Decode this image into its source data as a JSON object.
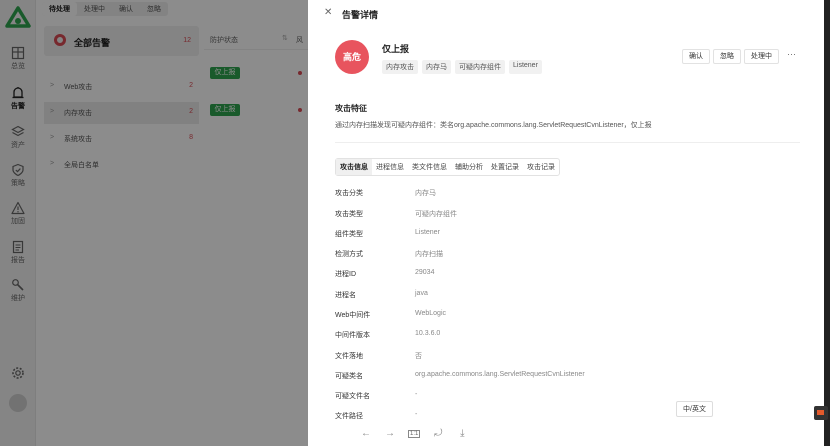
{
  "rail": {
    "items": [
      {
        "label": "总览",
        "icon": "dashboard-icon"
      },
      {
        "label": "告警",
        "icon": "alarm-icon"
      },
      {
        "label": "资产",
        "icon": "layers-icon"
      },
      {
        "label": "策略",
        "icon": "shield-icon"
      },
      {
        "label": "加固",
        "icon": "warning-icon"
      },
      {
        "label": "报告",
        "icon": "report-icon"
      },
      {
        "label": "维护",
        "icon": "wrench-icon"
      }
    ],
    "active_index": 1
  },
  "status_tabs": [
    "待处理",
    "处理中",
    "确认",
    "忽略"
  ],
  "categories": {
    "head": {
      "label": "全部告警",
      "count": "12"
    },
    "rows": [
      {
        "label": "Web攻击",
        "count": "2"
      },
      {
        "label": "内存攻击",
        "count": "2"
      },
      {
        "label": "系统攻击",
        "count": "8"
      },
      {
        "label": "全局白名单",
        "count": ""
      }
    ]
  },
  "list": {
    "col_status": "防护状态",
    "col_risk": "风",
    "tag": "仅上报"
  },
  "drawer": {
    "title": "告警详情",
    "level": "高危",
    "attack_name": "仅上报",
    "tags": [
      "内存攻击",
      "内存马",
      "可疑内存组件",
      "Listener"
    ],
    "actions": [
      "确认",
      "忽略",
      "处理中"
    ],
    "more": "···",
    "feature_title": "攻击特征",
    "feature_desc": "通过内存扫描发现可疑内存组件：类名org.apache.commons.lang.ServletRequestCvnListener，仅上报",
    "tabs": [
      "攻击信息",
      "进程信息",
      "类文件信息",
      "辅助分析",
      "处置记录",
      "攻击记录"
    ],
    "fields": [
      {
        "key": "攻击分类",
        "value": "内存马"
      },
      {
        "key": "攻击类型",
        "value": "可疑内存组件"
      },
      {
        "key": "组件类型",
        "value": "Listener"
      },
      {
        "key": "检测方式",
        "value": "内存扫描"
      },
      {
        "key": "进程ID",
        "value": "29034"
      },
      {
        "key": "进程名",
        "value": "java"
      },
      {
        "key": "Web中间件",
        "value": "WebLogic"
      },
      {
        "key": "中间件版本",
        "value": "10.3.6.0"
      },
      {
        "key": "文件落地",
        "value": "否"
      },
      {
        "key": "可疑类名",
        "value": "org.apache.commons.lang.ServletRequestCvnListener"
      },
      {
        "key": "可疑文件名",
        "value": "-"
      },
      {
        "key": "文件路径",
        "value": "-"
      }
    ],
    "lang_button": "中/英文"
  },
  "image_toolbar": {
    "actual_size_label": "1:1"
  },
  "colors": {
    "danger": "#e8545e",
    "success": "#2ea44f",
    "brand_green": "#2ea44f"
  }
}
